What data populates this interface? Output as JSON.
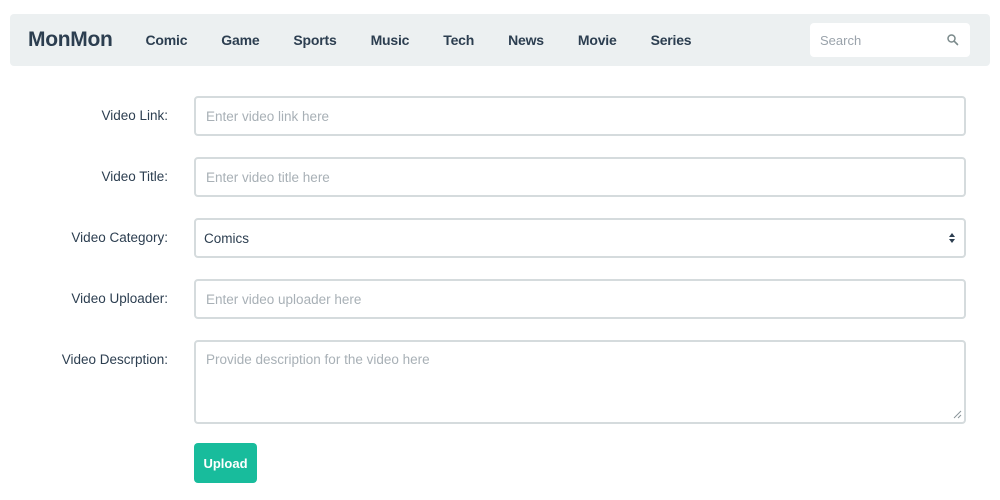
{
  "navbar": {
    "brand": "MonMon",
    "links": [
      "Comic",
      "Game",
      "Sports",
      "Music",
      "Tech",
      "News",
      "Movie",
      "Series"
    ],
    "search_placeholder": "Search"
  },
  "form": {
    "link_label": "Video Link:",
    "link_placeholder": "Enter video link here",
    "title_label": "Video Title:",
    "title_placeholder": "Enter video title here",
    "category_label": "Video Category:",
    "category_value": "Comics",
    "uploader_label": "Video Uploader:",
    "uploader_placeholder": "Enter video uploader here",
    "description_label": "Video Descrption:",
    "description_placeholder": "Provide description for the video here",
    "upload_label": "Upload"
  },
  "colors": {
    "navbar_bg": "#ecf0f1",
    "text": "#2c3e50",
    "accent": "#18bc9c"
  }
}
